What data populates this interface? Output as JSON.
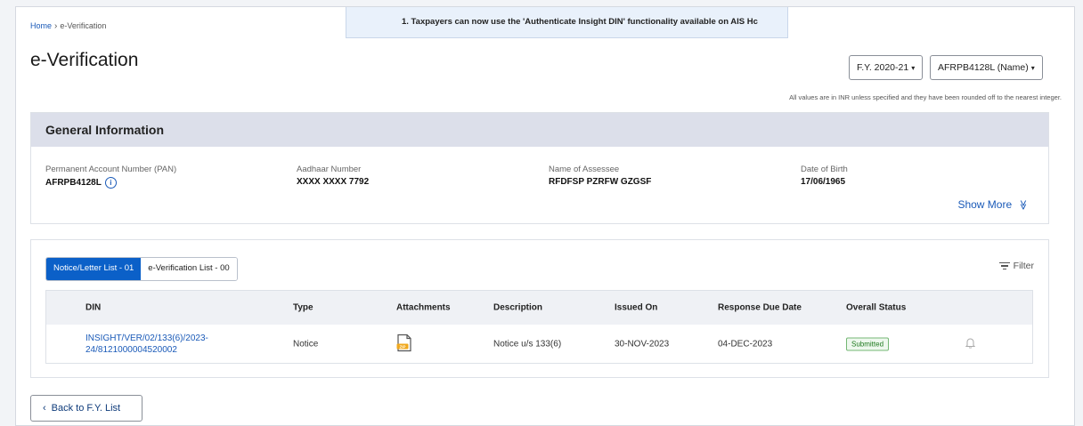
{
  "breadcrumb": {
    "home": "Home",
    "separator": "›",
    "current": "e-Verification"
  },
  "ticker": {
    "text": "1. Taxpayers can now use the 'Authenticate Insight DIN' functionality available on AIS Hc"
  },
  "page": {
    "title": "e-Verification"
  },
  "selectors": {
    "fy": "F.Y. 2020-21",
    "pan_name": "AFRPB4128L (Name)",
    "caret": "▾"
  },
  "note": "All values are in INR unless specified and they have been rounded off to the nearest integer.",
  "general_info": {
    "heading": "General Information",
    "fields": [
      {
        "label": "Permanent Account Number (PAN)",
        "value": "AFRPB4128L"
      },
      {
        "label": "Aadhaar Number",
        "value": "XXXX XXXX 7792"
      },
      {
        "label": "Name of Assessee",
        "value": "RFDFSP PZRFW GZGSF"
      },
      {
        "label": "Date of Birth",
        "value": "17/06/1965"
      }
    ],
    "show_more": "Show More",
    "show_more_icon": "≫"
  },
  "tabs": [
    {
      "label": "Notice/Letter List - 01",
      "active": true
    },
    {
      "label": "e-Verification List - 00",
      "active": false
    }
  ],
  "filter": {
    "label": "Filter"
  },
  "table": {
    "headers": [
      "DIN",
      "Type",
      "Attachments",
      "Description",
      "Issued On",
      "Response Due Date",
      "Overall Status"
    ],
    "rows": [
      {
        "din": "INSIGHT/VER/02/133(6)/2023-24/8121000004520002",
        "type": "Notice",
        "attachment_icon": "zip-file-icon",
        "description": "Notice u/s 133(6)",
        "issued_on": "30-NOV-2023",
        "due_date": "04-DEC-2023",
        "status": "Submitted"
      }
    ]
  },
  "back_button": {
    "label": "Back to F.Y. List",
    "icon": "‹"
  },
  "colors": {
    "accent": "#0b60c8",
    "link": "#1a5ab8",
    "header_bg": "#dcdfea",
    "status_green": "#1f7a1f"
  }
}
